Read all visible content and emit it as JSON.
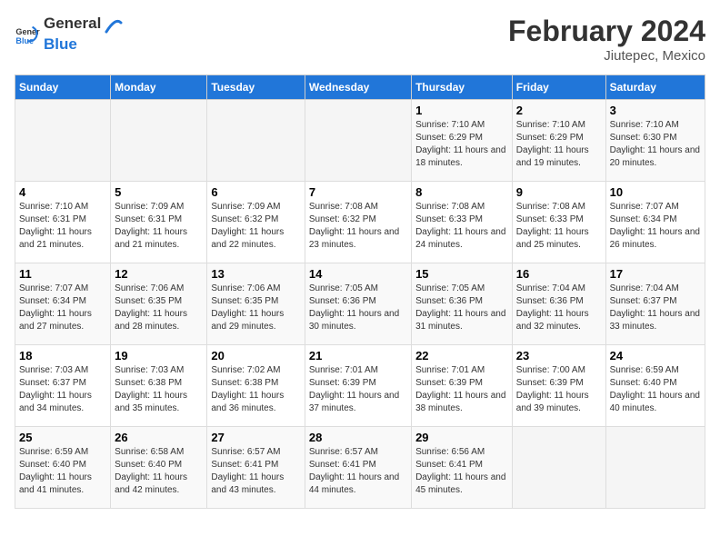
{
  "header": {
    "logo_general": "General",
    "logo_blue": "Blue",
    "main_title": "February 2024",
    "sub_title": "Jiutepec, Mexico"
  },
  "weekdays": [
    "Sunday",
    "Monday",
    "Tuesday",
    "Wednesday",
    "Thursday",
    "Friday",
    "Saturday"
  ],
  "weeks": [
    [
      {
        "day": "",
        "empty": true
      },
      {
        "day": "",
        "empty": true
      },
      {
        "day": "",
        "empty": true
      },
      {
        "day": "",
        "empty": true
      },
      {
        "day": "1",
        "sunrise": "7:10 AM",
        "sunset": "6:29 PM",
        "daylight": "11 hours and 18 minutes."
      },
      {
        "day": "2",
        "sunrise": "7:10 AM",
        "sunset": "6:29 PM",
        "daylight": "11 hours and 19 minutes."
      },
      {
        "day": "3",
        "sunrise": "7:10 AM",
        "sunset": "6:30 PM",
        "daylight": "11 hours and 20 minutes."
      }
    ],
    [
      {
        "day": "4",
        "sunrise": "7:10 AM",
        "sunset": "6:31 PM",
        "daylight": "11 hours and 21 minutes."
      },
      {
        "day": "5",
        "sunrise": "7:09 AM",
        "sunset": "6:31 PM",
        "daylight": "11 hours and 21 minutes."
      },
      {
        "day": "6",
        "sunrise": "7:09 AM",
        "sunset": "6:32 PM",
        "daylight": "11 hours and 22 minutes."
      },
      {
        "day": "7",
        "sunrise": "7:08 AM",
        "sunset": "6:32 PM",
        "daylight": "11 hours and 23 minutes."
      },
      {
        "day": "8",
        "sunrise": "7:08 AM",
        "sunset": "6:33 PM",
        "daylight": "11 hours and 24 minutes."
      },
      {
        "day": "9",
        "sunrise": "7:08 AM",
        "sunset": "6:33 PM",
        "daylight": "11 hours and 25 minutes."
      },
      {
        "day": "10",
        "sunrise": "7:07 AM",
        "sunset": "6:34 PM",
        "daylight": "11 hours and 26 minutes."
      }
    ],
    [
      {
        "day": "11",
        "sunrise": "7:07 AM",
        "sunset": "6:34 PM",
        "daylight": "11 hours and 27 minutes."
      },
      {
        "day": "12",
        "sunrise": "7:06 AM",
        "sunset": "6:35 PM",
        "daylight": "11 hours and 28 minutes."
      },
      {
        "day": "13",
        "sunrise": "7:06 AM",
        "sunset": "6:35 PM",
        "daylight": "11 hours and 29 minutes."
      },
      {
        "day": "14",
        "sunrise": "7:05 AM",
        "sunset": "6:36 PM",
        "daylight": "11 hours and 30 minutes."
      },
      {
        "day": "15",
        "sunrise": "7:05 AM",
        "sunset": "6:36 PM",
        "daylight": "11 hours and 31 minutes."
      },
      {
        "day": "16",
        "sunrise": "7:04 AM",
        "sunset": "6:36 PM",
        "daylight": "11 hours and 32 minutes."
      },
      {
        "day": "17",
        "sunrise": "7:04 AM",
        "sunset": "6:37 PM",
        "daylight": "11 hours and 33 minutes."
      }
    ],
    [
      {
        "day": "18",
        "sunrise": "7:03 AM",
        "sunset": "6:37 PM",
        "daylight": "11 hours and 34 minutes."
      },
      {
        "day": "19",
        "sunrise": "7:03 AM",
        "sunset": "6:38 PM",
        "daylight": "11 hours and 35 minutes."
      },
      {
        "day": "20",
        "sunrise": "7:02 AM",
        "sunset": "6:38 PM",
        "daylight": "11 hours and 36 minutes."
      },
      {
        "day": "21",
        "sunrise": "7:01 AM",
        "sunset": "6:39 PM",
        "daylight": "11 hours and 37 minutes."
      },
      {
        "day": "22",
        "sunrise": "7:01 AM",
        "sunset": "6:39 PM",
        "daylight": "11 hours and 38 minutes."
      },
      {
        "day": "23",
        "sunrise": "7:00 AM",
        "sunset": "6:39 PM",
        "daylight": "11 hours and 39 minutes."
      },
      {
        "day": "24",
        "sunrise": "6:59 AM",
        "sunset": "6:40 PM",
        "daylight": "11 hours and 40 minutes."
      }
    ],
    [
      {
        "day": "25",
        "sunrise": "6:59 AM",
        "sunset": "6:40 PM",
        "daylight": "11 hours and 41 minutes."
      },
      {
        "day": "26",
        "sunrise": "6:58 AM",
        "sunset": "6:40 PM",
        "daylight": "11 hours and 42 minutes."
      },
      {
        "day": "27",
        "sunrise": "6:57 AM",
        "sunset": "6:41 PM",
        "daylight": "11 hours and 43 minutes."
      },
      {
        "day": "28",
        "sunrise": "6:57 AM",
        "sunset": "6:41 PM",
        "daylight": "11 hours and 44 minutes."
      },
      {
        "day": "29",
        "sunrise": "6:56 AM",
        "sunset": "6:41 PM",
        "daylight": "11 hours and 45 minutes."
      },
      {
        "day": "",
        "empty": true
      },
      {
        "day": "",
        "empty": true
      }
    ]
  ],
  "labels": {
    "sunrise": "Sunrise:",
    "sunset": "Sunset:",
    "daylight": "Daylight:"
  }
}
